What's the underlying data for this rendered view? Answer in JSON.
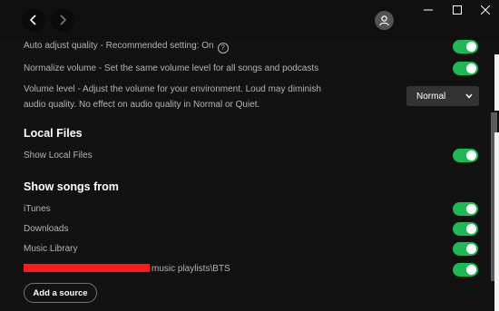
{
  "titlebar": {
    "back_icon": "chevron-left-icon",
    "forward_icon": "chevron-right-icon",
    "profile_icon": "user-icon",
    "window_controls": [
      "minimize-icon",
      "maximize-icon",
      "close-icon"
    ]
  },
  "settings": {
    "auto_adjust_label": "Auto adjust quality - Recommended setting: On",
    "auto_adjust_help": "?",
    "auto_adjust_on": true,
    "normalize_label": "Normalize volume - Set the same volume level for all songs and podcasts",
    "normalize_on": true,
    "volume_level_line1": "Volume level - Adjust the volume for your environment. Loud may diminish",
    "volume_level_line2": "audio quality. No effect on audio quality in Normal or Quiet.",
    "volume_level_value": "Normal"
  },
  "local_files": {
    "title": "Local Files",
    "show_local_label": "Show Local Files",
    "show_local_on": true
  },
  "show_songs_from": {
    "title": "Show songs from",
    "sources": [
      {
        "label": "iTunes",
        "on": true
      },
      {
        "label": "Downloads",
        "on": true
      },
      {
        "label": "Music Library",
        "on": true
      },
      {
        "label": "music playlists\\BTS",
        "on": true
      }
    ],
    "add_source_label": "Add a source"
  },
  "colors": {
    "accent": "#1db954",
    "background": "#121212",
    "redaction": "#ff1a1a"
  }
}
